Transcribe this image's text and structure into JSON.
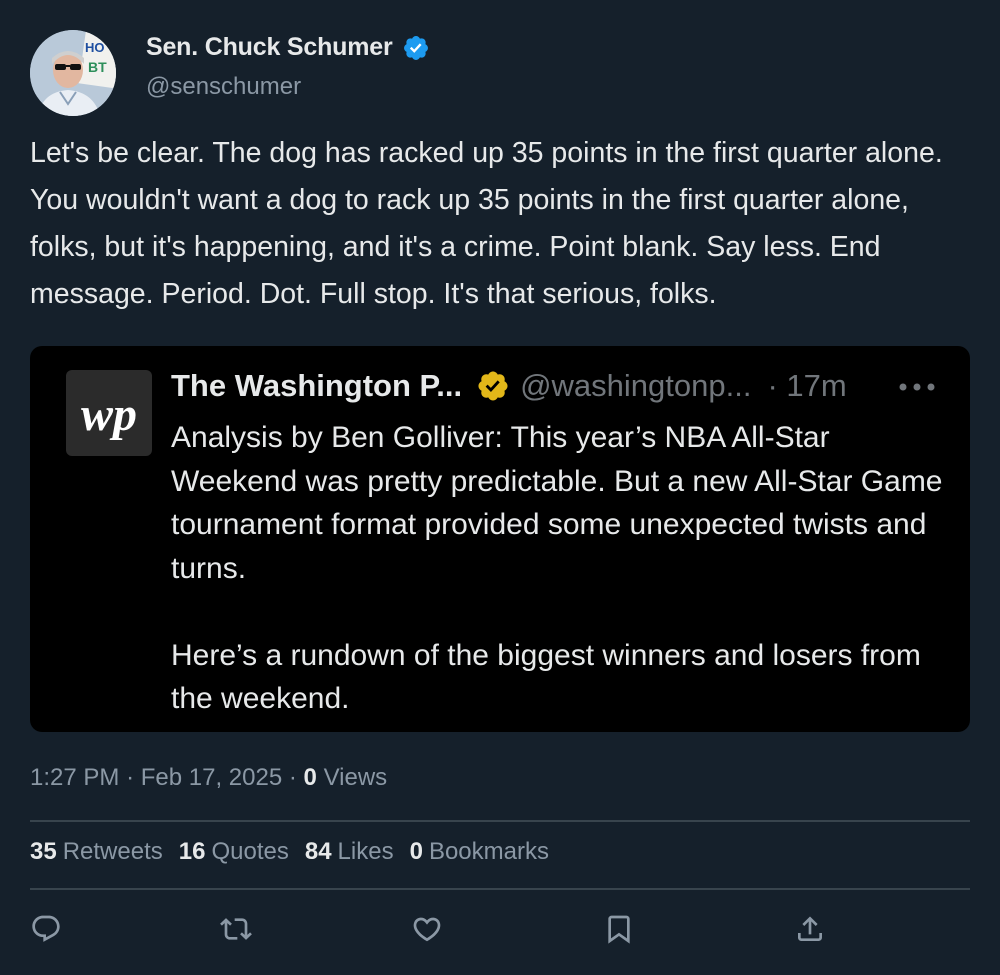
{
  "author": {
    "name": "Sen. Chuck Schumer",
    "handle": "@senschumer",
    "avatar_sign_text": "HO BT"
  },
  "tweet": {
    "text": "Let's be clear. The dog has racked up 35 points in the first quarter alone. You wouldn't want a dog to rack up 35 points in the first quarter alone, folks, but it's happening, and it's a crime. Point blank. Say less. End message. Period. Dot. Full stop. It's that serious, folks."
  },
  "quoted": {
    "logo_text": "wp",
    "name": "The Washington P...",
    "handle": "@washingtonp...",
    "time": "· 17m",
    "text": "Analysis by Ben Golliver: This year’s NBA All-Star Weekend was pretty predictable. But a new All-Star Game tournament format provided some unexpected twists and turns.\n\nHere’s a rundown of the biggest winners and losers from the weekend."
  },
  "meta": {
    "time": "1:27 PM",
    "date": "Feb 17, 2025",
    "views_count": "0",
    "views_label": "Views"
  },
  "stats": [
    {
      "count": "35",
      "label": "Retweets"
    },
    {
      "count": "16",
      "label": "Quotes"
    },
    {
      "count": "84",
      "label": "Likes"
    },
    {
      "count": "0",
      "label": "Bookmarks"
    }
  ],
  "colors": {
    "background": "#15202b",
    "verified_blue": "#1d9bf0",
    "verified_gold": "#e2b719"
  },
  "icons": [
    "reply-icon",
    "retweet-icon",
    "like-icon",
    "bookmark-icon",
    "share-icon",
    "more-icon"
  ]
}
